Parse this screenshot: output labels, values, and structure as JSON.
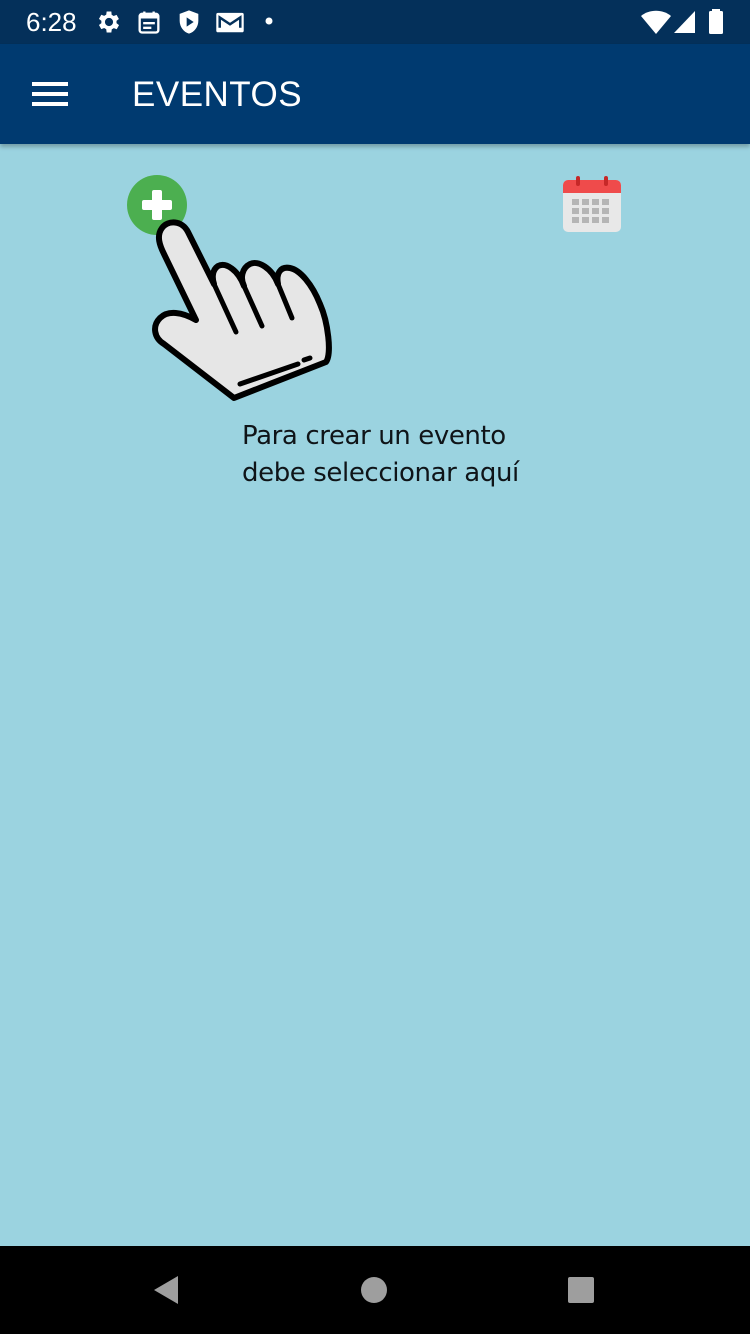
{
  "status_bar": {
    "time": "6:28",
    "left_icons": [
      "settings-icon",
      "calendar-note-icon",
      "shield-icon",
      "mail-icon",
      "notification-dot-icon"
    ],
    "right_icons": [
      "wifi-icon",
      "signal-icon",
      "battery-icon"
    ],
    "background": "#04305a"
  },
  "app_bar": {
    "title": "EVENTOS",
    "menu_icon": "hamburger-menu-icon",
    "background": "#003a70"
  },
  "content": {
    "background": "#9bd3e0",
    "add_icon": "add-event-icon",
    "add_color": "#43a047",
    "calendar_icon": "calendar-icon",
    "calendar_color": "#e53935",
    "pointer_icon": "hand-pointer-icon",
    "instruction_line1": "Para crear un evento",
    "instruction_line2": "debe seleccionar aquí"
  },
  "nav_bar": {
    "back": "back-icon",
    "home": "home-icon",
    "recents": "recents-icon"
  }
}
